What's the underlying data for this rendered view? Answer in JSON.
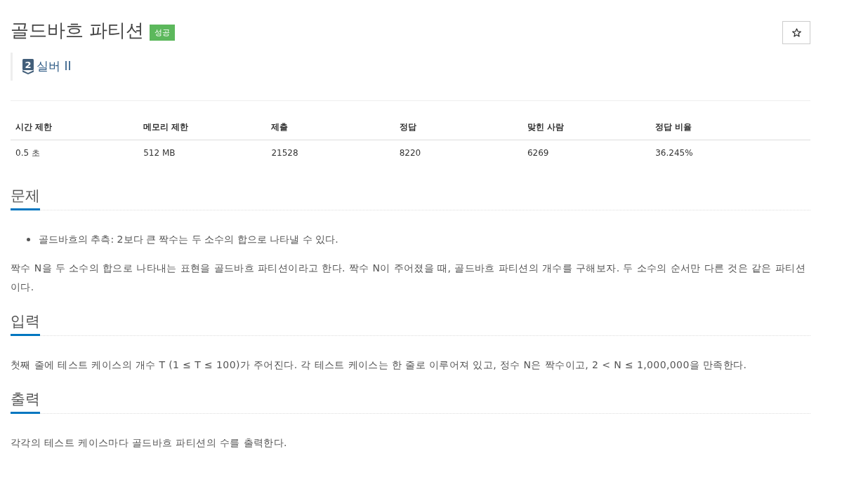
{
  "problem": {
    "title": "골드바흐 파티션",
    "result": {
      "text": "성공",
      "kind": "success"
    },
    "starred": false,
    "tier": {
      "number": "2",
      "label": "실버 II"
    }
  },
  "table": {
    "columns": [
      "시간 제한",
      "메모리 제한",
      "제출",
      "정답",
      "맞힌 사람",
      "정답 비율"
    ],
    "rows": [
      [
        "0.5 초",
        "512 MB",
        "21528",
        "8220",
        "6269",
        "36.245%"
      ]
    ]
  },
  "sections": [
    {
      "heading": "문제",
      "blocks": [
        {
          "kind": "bullets",
          "items": [
            "골드바흐의 추측: 2보다 큰 짝수는 두 소수의 합으로 나타낼 수 있다."
          ]
        },
        {
          "kind": "paragraph",
          "text": "짝수 N을 두 소수의 합으로 나타내는 표현을 골드바흐 파티션이라고 한다. 짝수 N이 주어졌을 때, 골드바흐 파티션의 개수를 구해보자. 두 소수의 순서만 다른 것은 같은 파티션이다."
        }
      ]
    },
    {
      "heading": "입력",
      "blocks": [
        {
          "kind": "paragraph",
          "text": "첫째 줄에 테스트 케이스의 개수 T (1 ≤ T ≤ 100)가 주어진다. 각 테스트 케이스는 한 줄로 이루어져 있고, 정수 N은 짝수이고, 2 < N ≤ 1,000,000을 만족한다."
        }
      ]
    },
    {
      "heading": "출력",
      "blocks": [
        {
          "kind": "paragraph",
          "text": "각각의 테스트 케이스마다 골드바흐 파티션의 수를 출력한다."
        }
      ]
    }
  ]
}
